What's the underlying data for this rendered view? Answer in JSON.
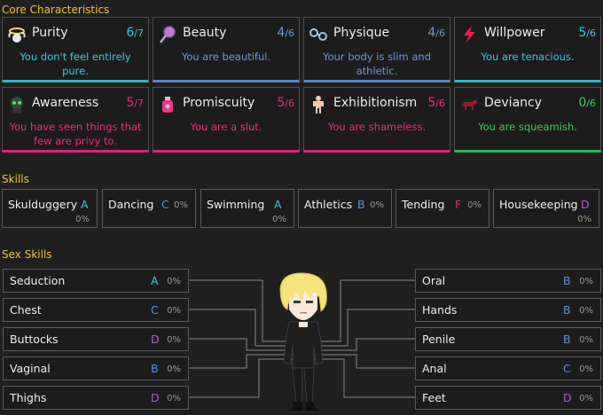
{
  "sections": {
    "core": "Core Characteristics",
    "skills": "Skills",
    "sex_skills": "Sex Skills"
  },
  "core": [
    {
      "name": "Purity",
      "value": "6",
      "max": "/7",
      "desc": "You don't feel entirely pure.",
      "theme": "teal",
      "icon": "halo-icon"
    },
    {
      "name": "Beauty",
      "value": "4",
      "max": "/6",
      "desc": "You are beautiful.",
      "theme": "teal",
      "icon": "mirror-icon"
    },
    {
      "name": "Physique",
      "value": "4",
      "max": "/6",
      "desc": "Your body is slim and athletic.",
      "theme": "teal",
      "icon": "dumbbell-icon"
    },
    {
      "name": "Willpower",
      "value": "5",
      "max": "/6",
      "desc": "You are tenacious.",
      "theme": "teal",
      "icon": "lightning-icon"
    },
    {
      "name": "Awareness",
      "value": "5",
      "max": "/7",
      "desc": "You have seen things that few are privy to.",
      "theme": "pink",
      "icon": "eye-icon"
    },
    {
      "name": "Promiscuity",
      "value": "5",
      "max": "/6",
      "desc": "You are a slut.",
      "theme": "pink",
      "icon": "potion-icon"
    },
    {
      "name": "Exhibitionism",
      "value": "5",
      "max": "/6",
      "desc": "You are shameless.",
      "theme": "pink",
      "icon": "figure-icon"
    },
    {
      "name": "Deviancy",
      "value": "0",
      "max": "/6",
      "desc": "You are squeamish.",
      "theme": "green",
      "icon": "beast-icon"
    }
  ],
  "skills": [
    {
      "name": "Skulduggery",
      "grade": "A",
      "pct": "0%"
    },
    {
      "name": "Dancing",
      "grade": "C",
      "pct": "0%"
    },
    {
      "name": "Swimming",
      "grade": "A",
      "pct": "0%"
    },
    {
      "name": "Athletics",
      "grade": "B",
      "pct": "0%"
    },
    {
      "name": "Tending",
      "grade": "F",
      "pct": "0%"
    },
    {
      "name": "Housekeeping",
      "grade": "D",
      "pct": "0%"
    }
  ],
  "sex_left": [
    {
      "name": "Seduction",
      "grade": "A",
      "pct": "0%"
    },
    {
      "name": "Chest",
      "grade": "C",
      "pct": "0%"
    },
    {
      "name": "Buttocks",
      "grade": "D",
      "pct": "0%"
    },
    {
      "name": "Vaginal",
      "grade": "B",
      "pct": "0%"
    },
    {
      "name": "Thighs",
      "grade": "D",
      "pct": "0%"
    }
  ],
  "sex_right": [
    {
      "name": "Oral",
      "grade": "B",
      "pct": "0%"
    },
    {
      "name": "Hands",
      "grade": "B",
      "pct": "0%"
    },
    {
      "name": "Penile",
      "grade": "B",
      "pct": "0%"
    },
    {
      "name": "Anal",
      "grade": "C",
      "pct": "0%"
    },
    {
      "name": "Feet",
      "grade": "D",
      "pct": "0%"
    }
  ]
}
